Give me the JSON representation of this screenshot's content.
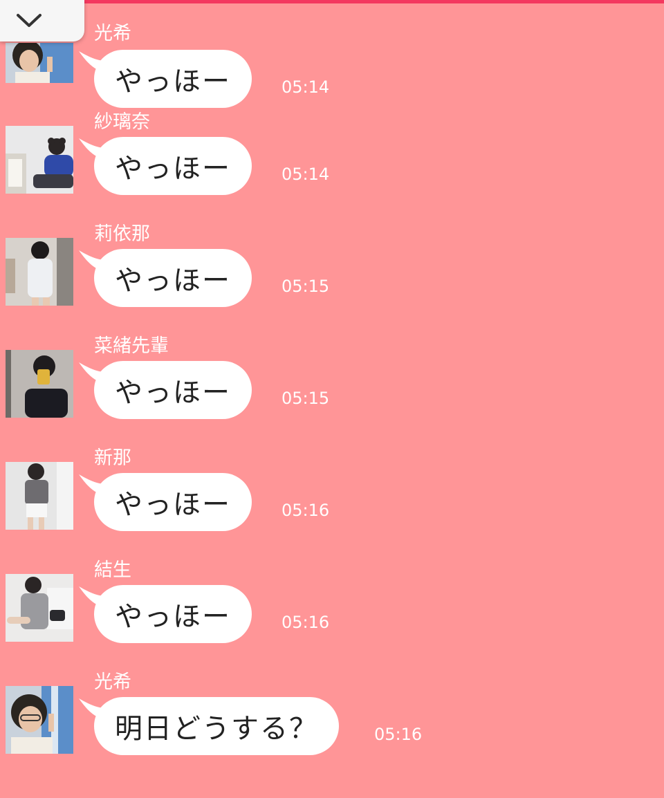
{
  "colors": {
    "background": "#ff9597",
    "top_accent": "#f4385f",
    "bubble": "#ffffff",
    "bubble_text": "#222222",
    "meta_text": "#ffffff"
  },
  "collapse_button": {
    "icon": "chevron-down-icon"
  },
  "messages": [
    {
      "sender": "光希",
      "text": "やっほー",
      "time": "05:14",
      "avatar": "avatar-photo"
    },
    {
      "sender": "紗璃奈",
      "text": "やっほー",
      "time": "05:14",
      "avatar": "avatar-photo"
    },
    {
      "sender": "莉依那",
      "text": "やっほー",
      "time": "05:15",
      "avatar": "avatar-photo"
    },
    {
      "sender": "菜緒先輩",
      "text": "やっほー",
      "time": "05:15",
      "avatar": "avatar-photo"
    },
    {
      "sender": "新那",
      "text": "やっほー",
      "time": "05:16",
      "avatar": "avatar-photo"
    },
    {
      "sender": "結生",
      "text": "やっほー",
      "time": "05:16",
      "avatar": "avatar-photo"
    },
    {
      "sender": "光希",
      "text": "明日どうする？",
      "time": "05:16",
      "avatar": "avatar-photo"
    }
  ]
}
